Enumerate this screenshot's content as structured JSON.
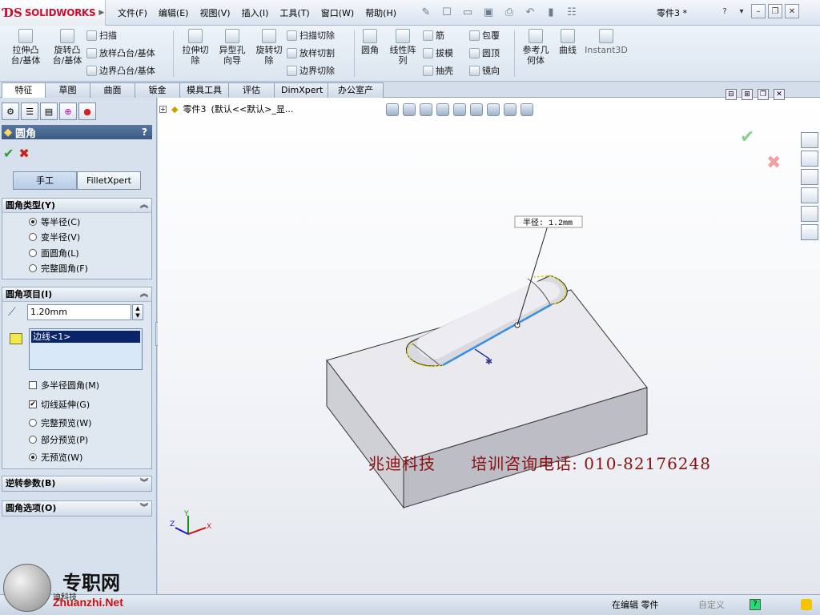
{
  "app": {
    "brand": "SOLIDWORKS",
    "doc_title": "零件3 *"
  },
  "menu": [
    "文件(F)",
    "编辑(E)",
    "视图(V)",
    "插入(I)",
    "工具(T)",
    "窗口(W)",
    "帮助(H)"
  ],
  "ribbon": {
    "big": [
      "拉伸凸\n台/基体",
      "旋转凸\n台/基体",
      "拉伸切\n除",
      "异型孔\n向导",
      "旋转切\n除",
      "圆角",
      "线性阵\n列",
      "参考几\n何体",
      "曲线",
      "Instant3D"
    ],
    "small": [
      "扫描",
      "放样凸台/基体",
      "边界凸台/基体",
      "扫描切除",
      "放样切割",
      "边界切除",
      "筋",
      "拔模",
      "抽壳",
      "包覆",
      "圆顶",
      "镜向"
    ]
  },
  "tabs": [
    "特征",
    "草图",
    "曲面",
    "钣金",
    "模具工具",
    "评估",
    "DimXpert",
    "办公室产品"
  ],
  "tree": {
    "node": "零件3",
    "config": "(默认<<默认>_显..."
  },
  "property_manager": {
    "title": "圆角",
    "help": "?",
    "modes": [
      "手工",
      "FilletXpert"
    ],
    "fillet_type": {
      "header": "圆角类型(Y)",
      "options": [
        "等半径(C)",
        "变半径(V)",
        "面圆角(L)",
        "完整圆角(F)"
      ],
      "selected": 0
    },
    "items": {
      "header": "圆角项目(I)",
      "radius": "1.20mm",
      "edge": "边线<1>",
      "options": [
        "多半径圆角(M)",
        "切线延伸(G)",
        "完整预览(W)",
        "部分预览(P)",
        "无预览(W)"
      ]
    },
    "setback": "逆转参数(B)",
    "fillet_options": "圆角选项(O)"
  },
  "viewport": {
    "callout": "半径: 1.2mm",
    "axes": [
      "Y",
      "Z",
      "X"
    ]
  },
  "status": {
    "editing": "在编辑 零件",
    "custom": "自定义"
  },
  "watermark": {
    "company": "兆迪科技",
    "phone": "培训咨询电话: 010-82176248",
    "site_logo": "专职网",
    "site_url": "Zhuanzhi.Net",
    "tech": "迪科技"
  }
}
